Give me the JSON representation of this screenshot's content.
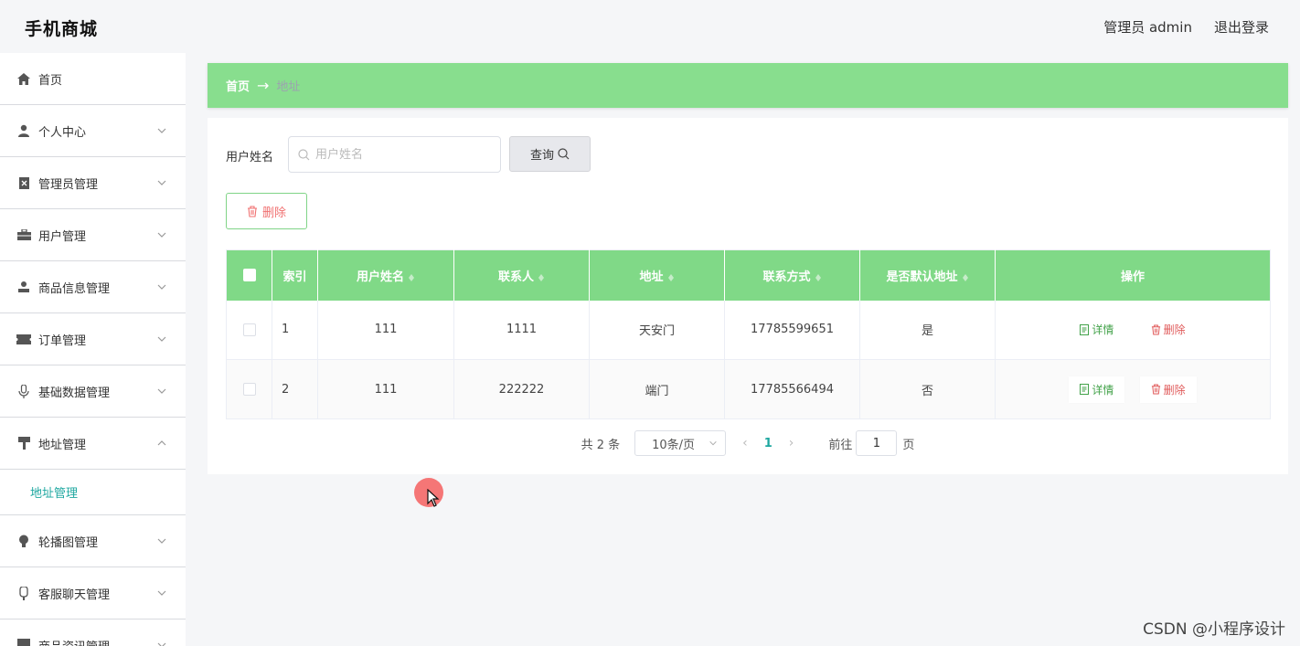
{
  "app": {
    "title": "手机商城"
  },
  "header": {
    "user_label": "管理员 admin",
    "logout": "退出登录"
  },
  "sidebar": {
    "items": [
      {
        "label": "首页",
        "icon": "home-icon",
        "chevron": false
      },
      {
        "label": "个人中心",
        "icon": "user-icon",
        "chevron": "down"
      },
      {
        "label": "管理员管理",
        "icon": "clipboard-icon",
        "chevron": "down"
      },
      {
        "label": "用户管理",
        "icon": "briefcase-icon",
        "chevron": "down"
      },
      {
        "label": "商品信息管理",
        "icon": "person-icon",
        "chevron": "down"
      },
      {
        "label": "订单管理",
        "icon": "ticket-icon",
        "chevron": "down"
      },
      {
        "label": "基础数据管理",
        "icon": "microphone-icon",
        "chevron": "down"
      },
      {
        "label": "地址管理",
        "icon": "pin-icon",
        "chevron": "up",
        "expanded": true
      },
      {
        "label": "轮播图管理",
        "icon": "bulb-icon",
        "chevron": "down"
      },
      {
        "label": "客服聊天管理",
        "icon": "mic-icon",
        "chevron": "down"
      },
      {
        "label": "商品资讯管理",
        "icon": "news-icon",
        "chevron": "down"
      }
    ],
    "sub_item": "地址管理"
  },
  "breadcrumb": {
    "home": "首页",
    "arrow": "→",
    "current": "地址"
  },
  "search": {
    "label": "用户姓名",
    "placeholder": "用户姓名",
    "button": "查询"
  },
  "toolbar": {
    "delete_label": "删除"
  },
  "table": {
    "columns": [
      "索引",
      "用户姓名",
      "联系人",
      "地址",
      "联系方式",
      "是否默认地址",
      "操作"
    ],
    "rows": [
      {
        "index": "1",
        "user_name": "111",
        "contact": "1111",
        "address": "天安门",
        "phone": "17785599651",
        "is_default": "是"
      },
      {
        "index": "2",
        "user_name": "111",
        "contact": "222222",
        "address": "端门",
        "phone": "17785566494",
        "is_default": "否"
      }
    ],
    "actions": {
      "detail": "详情",
      "delete": "删除"
    }
  },
  "pagination": {
    "total_text": "共 2 条",
    "page_size": "10条/页",
    "current_page": "1",
    "goto_label": "前往",
    "goto_value": "1",
    "page_suffix": "页"
  },
  "watermark": "CSDN @小程序设计",
  "colors": {
    "accent_green": "#88de8e",
    "header_green": "#80d987",
    "teal": "#1ea7a0",
    "danger": "#e05a5a"
  }
}
